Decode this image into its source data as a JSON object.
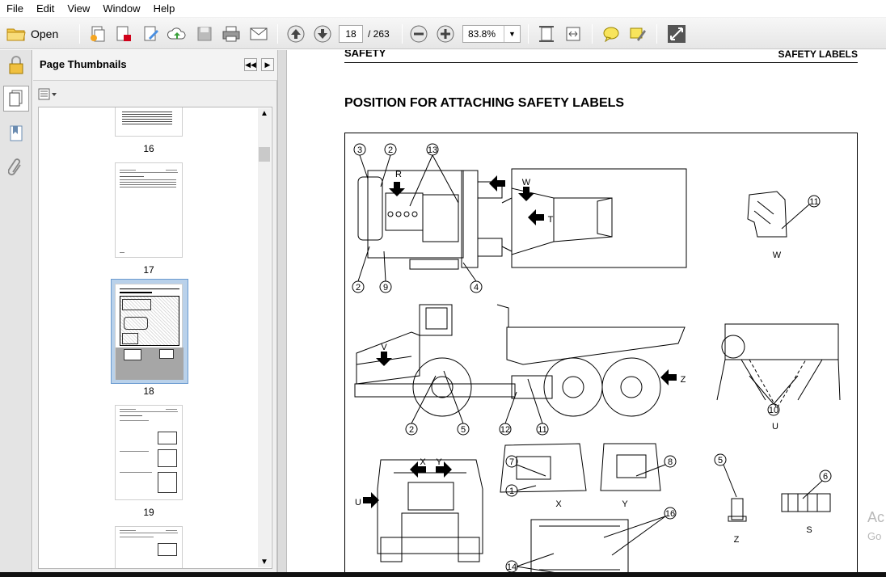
{
  "menu": [
    "File",
    "Edit",
    "View",
    "Window",
    "Help"
  ],
  "toolbar": {
    "open_label": "Open",
    "current_page": "18",
    "page_total": "/ 263",
    "zoom": "83.8%",
    "icons": [
      "open-folder-icon",
      "create-pdf-icon",
      "convert-icon",
      "edit-icon",
      "upload-icon",
      "save-icon",
      "print-icon",
      "email-icon",
      "page-up-icon",
      "page-down-icon",
      "zoom-out-icon",
      "zoom-in-icon",
      "fit-page-icon",
      "fit-width-icon",
      "comment-icon",
      "highlight-icon",
      "expand-icon"
    ]
  },
  "thumbnails": {
    "title": "Page Thumbnails",
    "pages": [
      "16",
      "17",
      "18",
      "19"
    ],
    "selected": "18"
  },
  "document": {
    "header_left": "SAFETY",
    "header_right": "SAFETY LABELS",
    "heading": "POSITION FOR ATTACHING SAFETY LABELS",
    "figure_callouts": [
      "1",
      "2",
      "3",
      "4",
      "5",
      "6",
      "7",
      "8",
      "9",
      "10",
      "11",
      "12",
      "13",
      "14",
      "16"
    ],
    "figure_views": [
      "R",
      "S",
      "T",
      "U",
      "V",
      "W",
      "X",
      "Y",
      "Z"
    ]
  },
  "watermark": {
    "line1": "Ac",
    "line2": "Go"
  },
  "colors": {
    "selected_thumb": "#b9d1ea",
    "toolbar_bg": "#ececec"
  }
}
